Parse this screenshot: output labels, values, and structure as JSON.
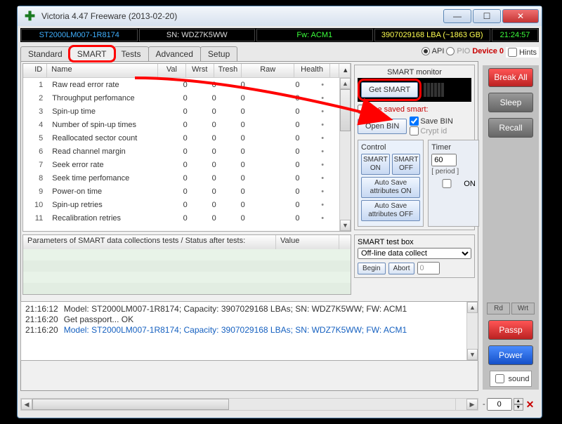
{
  "window": {
    "title": "Victoria 4.47  Freeware (2013-02-20)"
  },
  "status": {
    "drive": "ST2000LM007-1R8174",
    "sn": "SN: WDZ7K5WW",
    "fw": "Fw: ACM1",
    "lba": "3907029168 LBA (~1863 GB)",
    "clock": "21:24:57"
  },
  "tabs": [
    "Standard",
    "SMART",
    "Tests",
    "Advanced",
    "Setup"
  ],
  "apipio": {
    "api": "API",
    "pio": "PIO",
    "device": "Device 0"
  },
  "hints": "Hints",
  "grid": {
    "headers": {
      "id": "ID",
      "name": "Name",
      "val": "Val",
      "wrst": "Wrst",
      "tresh": "Tresh",
      "raw": "Raw",
      "health": "Health"
    },
    "rows": [
      {
        "id": "1",
        "name": "Raw read error rate",
        "val": "0",
        "wrst": "0",
        "tresh": "0",
        "raw": "0",
        "health": "•"
      },
      {
        "id": "2",
        "name": "Throughput perfomance",
        "val": "0",
        "wrst": "0",
        "tresh": "0",
        "raw": "0",
        "health": "•"
      },
      {
        "id": "3",
        "name": "Spin-up time",
        "val": "0",
        "wrst": "0",
        "tresh": "0",
        "raw": "0",
        "health": "•"
      },
      {
        "id": "4",
        "name": "Number of spin-up times",
        "val": "0",
        "wrst": "0",
        "tresh": "0",
        "raw": "0",
        "health": "•"
      },
      {
        "id": "5",
        "name": "Reallocated sector count",
        "val": "0",
        "wrst": "0",
        "tresh": "0",
        "raw": "0",
        "health": "•"
      },
      {
        "id": "6",
        "name": "Read channel margin",
        "val": "0",
        "wrst": "0",
        "tresh": "0",
        "raw": "0",
        "health": "•"
      },
      {
        "id": "7",
        "name": "Seek error rate",
        "val": "0",
        "wrst": "0",
        "tresh": "0",
        "raw": "0",
        "health": "•"
      },
      {
        "id": "8",
        "name": "Seek time perfomance",
        "val": "0",
        "wrst": "0",
        "tresh": "0",
        "raw": "0",
        "health": "•"
      },
      {
        "id": "9",
        "name": "Power-on time",
        "val": "0",
        "wrst": "0",
        "tresh": "0",
        "raw": "0",
        "health": "•"
      },
      {
        "id": "10",
        "name": "Spin-up retries",
        "val": "0",
        "wrst": "0",
        "tresh": "0",
        "raw": "0",
        "health": "•"
      },
      {
        "id": "11",
        "name": "Recalibration retries",
        "val": "0",
        "wrst": "0",
        "tresh": "0",
        "raw": "0",
        "health": "•"
      }
    ]
  },
  "paramgrid": {
    "col1": "Parameters of SMART data collections tests / Status after tests:",
    "col2": "Value"
  },
  "smart_panel": {
    "title": "SMART monitor",
    "get_smart": "Get SMART",
    "openbin": "Open BIN",
    "usesmart": "Use saved smart:",
    "savebin": "Save BIN",
    "cryptid": "Crypt id",
    "control": "Control",
    "smart_on": "SMART ON",
    "smart_off": "SMART OFF",
    "auto_on": "Auto Save attributes ON",
    "auto_off": "Auto Save attributes OFF",
    "timer": "Timer",
    "timer_val": "60",
    "period": "[ period ]",
    "on": "ON",
    "testbox": "SMART test box",
    "select": "Off-line data collect",
    "begin": "Begin",
    "abort": "Abort",
    "num": "0"
  },
  "side": {
    "break": "Break All",
    "sleep": "Sleep",
    "recall": "Recall",
    "rd": "Rd",
    "wrt": "Wrt",
    "passp": "Passp",
    "power": "Power",
    "sound": "sound",
    "spinner": "0"
  },
  "log": [
    {
      "ts": "21:16:12",
      "msg": "Model: ST2000LM007-1R8174; Capacity: 3907029168 LBAs; SN: WDZ7K5WW; FW: ACM1",
      "blue": false
    },
    {
      "ts": "21:16:20",
      "msg": "Get passport... OK",
      "blue": false
    },
    {
      "ts": "21:16:20",
      "msg": "Model: ST2000LM007-1R8174; Capacity: 3907029168 LBAs; SN: WDZ7K5WW; FW: ACM1",
      "blue": true
    }
  ]
}
